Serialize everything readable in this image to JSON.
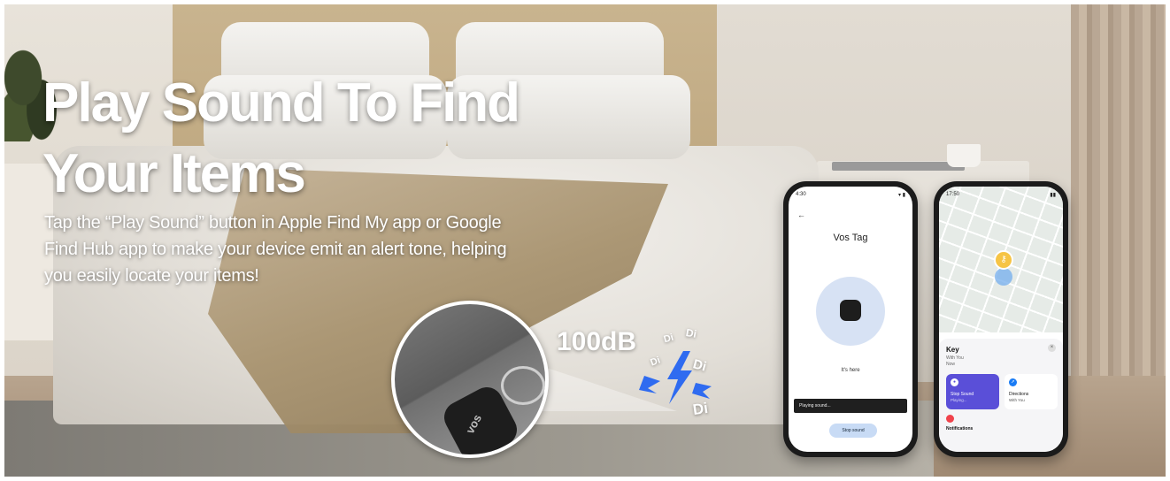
{
  "headline": {
    "line1": "Play Sound To Find",
    "line2": "Your Items"
  },
  "subtitle": {
    "line1": "Tap the “Play Sound” button in Apple Find My app or Google",
    "line2": "Find Hub app to make your device emit an alert tone, helping",
    "line3": "you easily locate your items!"
  },
  "zoom": {
    "tag_brand": "vos"
  },
  "sound": {
    "level": "100dB",
    "words": [
      "Di",
      "Di",
      "Di",
      "Di",
      "Di"
    ]
  },
  "android_phone": {
    "time": "4:30",
    "tag_name": "Vos Tag",
    "found_text": "It's here",
    "toast": "Playing sound...",
    "stop_button": "Stop sound"
  },
  "iphone": {
    "time": "17:50",
    "item_title": "Key",
    "item_sub_1": "With You",
    "item_sub_2": "Now",
    "actions": [
      {
        "label": "Stop Sound",
        "sub": "Playing..."
      },
      {
        "label": "Directions",
        "sub": "With You"
      }
    ],
    "notifications_label": "Notifications"
  },
  "colors": {
    "accent_purple": "#5a4fd8",
    "accent_blue": "#1a7cf5",
    "sound_blue": "#2f6bf0"
  }
}
